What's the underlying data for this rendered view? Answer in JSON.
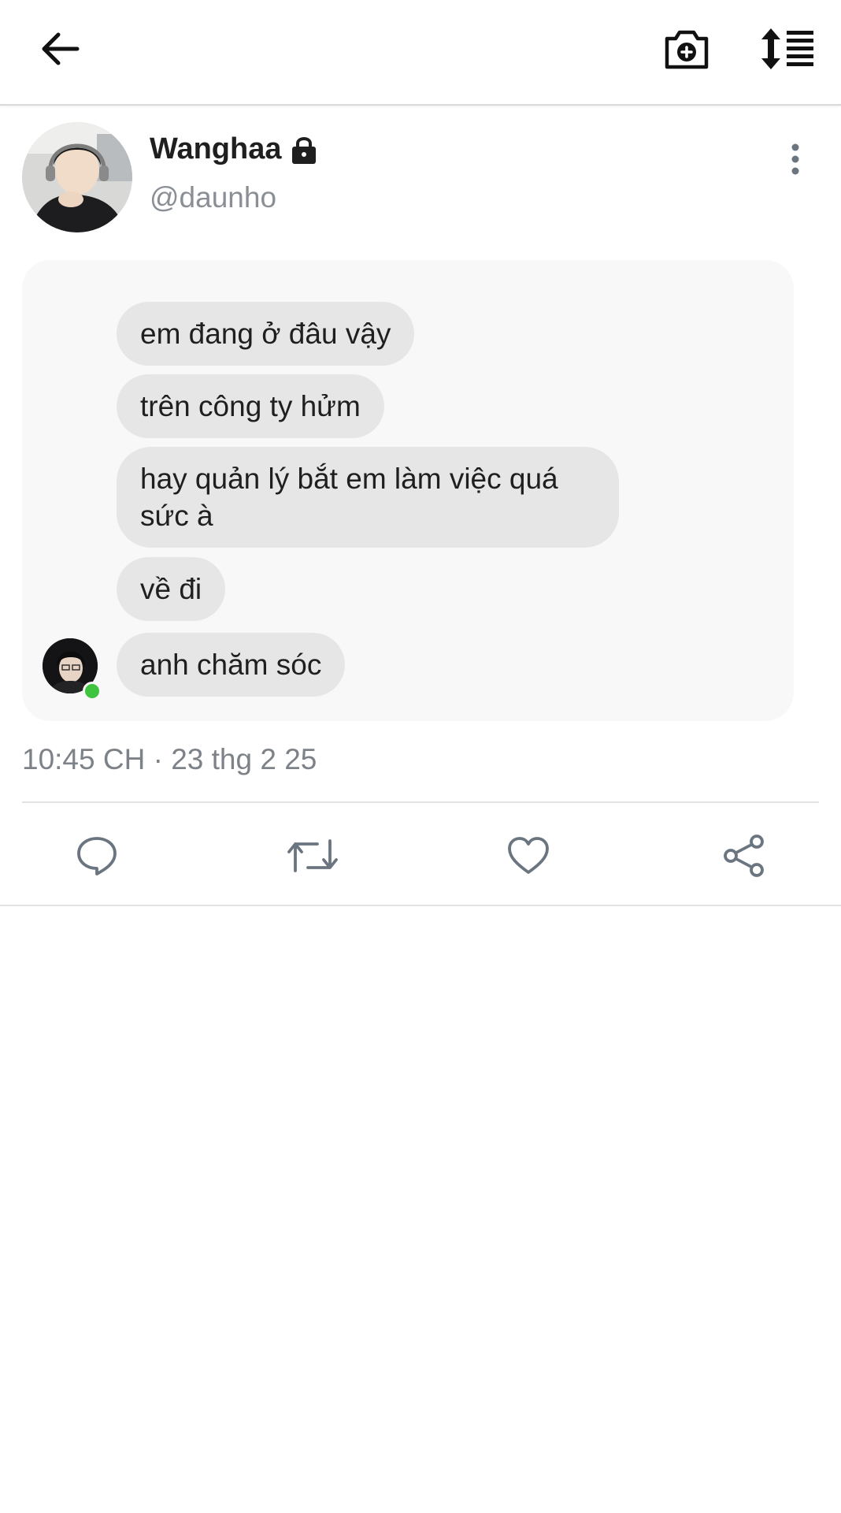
{
  "topbar": {
    "back_icon": "arrow-left-icon",
    "camera_icon": "camera-plus-icon",
    "sort_icon": "sort-list-icon"
  },
  "tweet": {
    "display_name": "Wanghaa",
    "lock_icon": "lock-icon",
    "handle": "@daunho",
    "more_icon": "more-vertical-icon",
    "timestamp": "10:45 CH · 23 thg 2 25"
  },
  "chat": {
    "messages": [
      "em đang ở đâu vậy",
      "trên công ty hửm",
      "hay quản lý bắt em làm việc quá sức à",
      "về đi",
      "anh chăm sóc"
    ],
    "online_color": "#3fc43f"
  },
  "actions": {
    "reply_icon": "reply-icon",
    "retweet_icon": "retweet-icon",
    "like_icon": "heart-icon",
    "share_icon": "share-icon"
  },
  "colors": {
    "icon": "#6b7580",
    "bubble": "#e6e6e6",
    "card": "#f8f8f8"
  }
}
